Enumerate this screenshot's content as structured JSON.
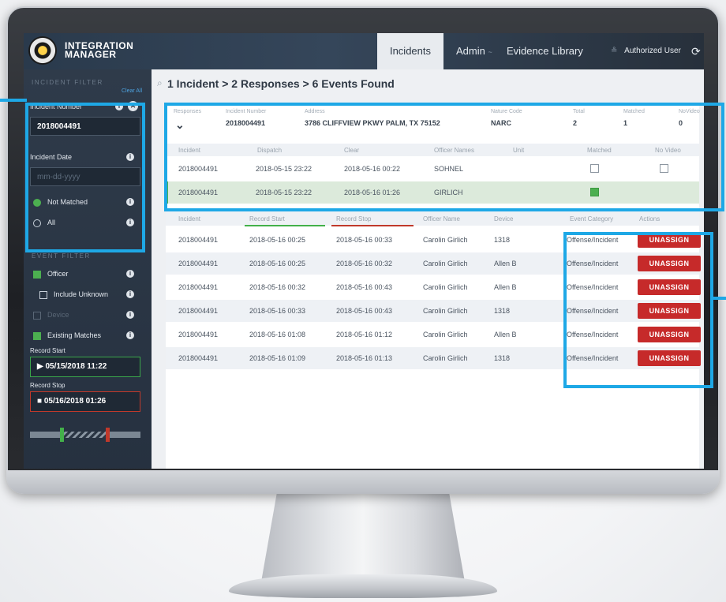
{
  "app": {
    "logo_line1": "INTEGRATION",
    "logo_line2": "MANAGER"
  },
  "nav": {
    "incidents": "Incidents",
    "admin": "Admin",
    "admin_caret": "~",
    "evidence": "Evidence Library",
    "user": "Authorized User",
    "logout_icon": "logout-icon"
  },
  "sidebar": {
    "incident_filter_title": "INCIDENT FILTER",
    "clear_all": "Clear All",
    "incident_number_label": "Incident Number",
    "incident_number_value": "2018004491",
    "incident_date_label": "Incident Date",
    "incident_date_placeholder": "mm-dd-yyyy",
    "not_matched_label": "Not Matched",
    "all_label": "All",
    "event_filter_title": "EVENT FILTER",
    "officer_label": "Officer",
    "include_unknown_label": "Include Unknown",
    "device_label": "Device",
    "existing_matches_label": "Existing Matches",
    "record_start_label": "Record Start",
    "record_start_value": "05/15/2018 11:22",
    "record_stop_label": "Record Stop",
    "record_stop_value": "05/16/2018 01:26",
    "info_glyph": "i",
    "clear_glyph": "✕"
  },
  "summary": {
    "text": "1 Incident > 2 Responses > 6 Events Found",
    "icon": "search-icon"
  },
  "incident_header": {
    "responses_label": "Responses",
    "incident_number_label": "Incident Number",
    "incident_number_value": "2018004491",
    "address_label": "Address",
    "address_value": "3786 CLIFFVIEW PKWY PALM, TX 75152",
    "nature_code_label": "Nature Code",
    "nature_code_value": "NARC",
    "total_label": "Total",
    "total_value": "2",
    "matched_label": "Matched",
    "matched_value": "1",
    "novideo_label": "NoVideo",
    "novideo_value": "0",
    "expand_glyph": "⌄"
  },
  "responses": {
    "columns": [
      "Incident",
      "Dispatch",
      "Clear",
      "Officer Names",
      "Unit",
      "Matched",
      "No Video"
    ],
    "rows": [
      {
        "incident": "2018004491",
        "dispatch": "2018-05-15 23:22",
        "clear": "2018-05-16 00:22",
        "officer": "SOHNEL",
        "unit": "",
        "matched": false,
        "no_video": false
      },
      {
        "incident": "2018004491",
        "dispatch": "2018-05-15 23:22",
        "clear": "2018-05-16 01:26",
        "officer": "GIRLICH",
        "unit": "",
        "matched": true,
        "no_video": null
      }
    ]
  },
  "events": {
    "columns": [
      "Incident",
      "Record Start",
      "Record Stop",
      "Officer Name",
      "Device",
      "Event Category",
      "Actions"
    ],
    "action_label": "UNASSIGN",
    "rows": [
      {
        "incident": "2018004491",
        "start": "2018-05-16 00:25",
        "stop": "2018-05-16 00:33",
        "officer": "Carolin Girlich",
        "device": "1318",
        "category": "Offense/Incident"
      },
      {
        "incident": "2018004491",
        "start": "2018-05-16 00:25",
        "stop": "2018-05-16 00:32",
        "officer": "Carolin Girlich",
        "device": "Allen B",
        "category": "Offense/Incident"
      },
      {
        "incident": "2018004491",
        "start": "2018-05-16 00:32",
        "stop": "2018-05-16 00:43",
        "officer": "Carolin Girlich",
        "device": "Allen B",
        "category": "Offense/Incident"
      },
      {
        "incident": "2018004491",
        "start": "2018-05-16 00:33",
        "stop": "2018-05-16 00:43",
        "officer": "Carolin Girlich",
        "device": "1318",
        "category": "Offense/Incident"
      },
      {
        "incident": "2018004491",
        "start": "2018-05-16 01:08",
        "stop": "2018-05-16 01:12",
        "officer": "Carolin Girlich",
        "device": "Allen B",
        "category": "Offense/Incident"
      },
      {
        "incident": "2018004491",
        "start": "2018-05-16 01:09",
        "stop": "2018-05-16 01:13",
        "officer": "Carolin Girlich",
        "device": "1318",
        "category": "Offense/Incident"
      }
    ]
  },
  "colors": {
    "accent_callout": "#1ea8e6",
    "unassign_red": "#c62a2a",
    "matched_green": "#4caf50",
    "sidebar_bg": "#2f3b4a"
  }
}
